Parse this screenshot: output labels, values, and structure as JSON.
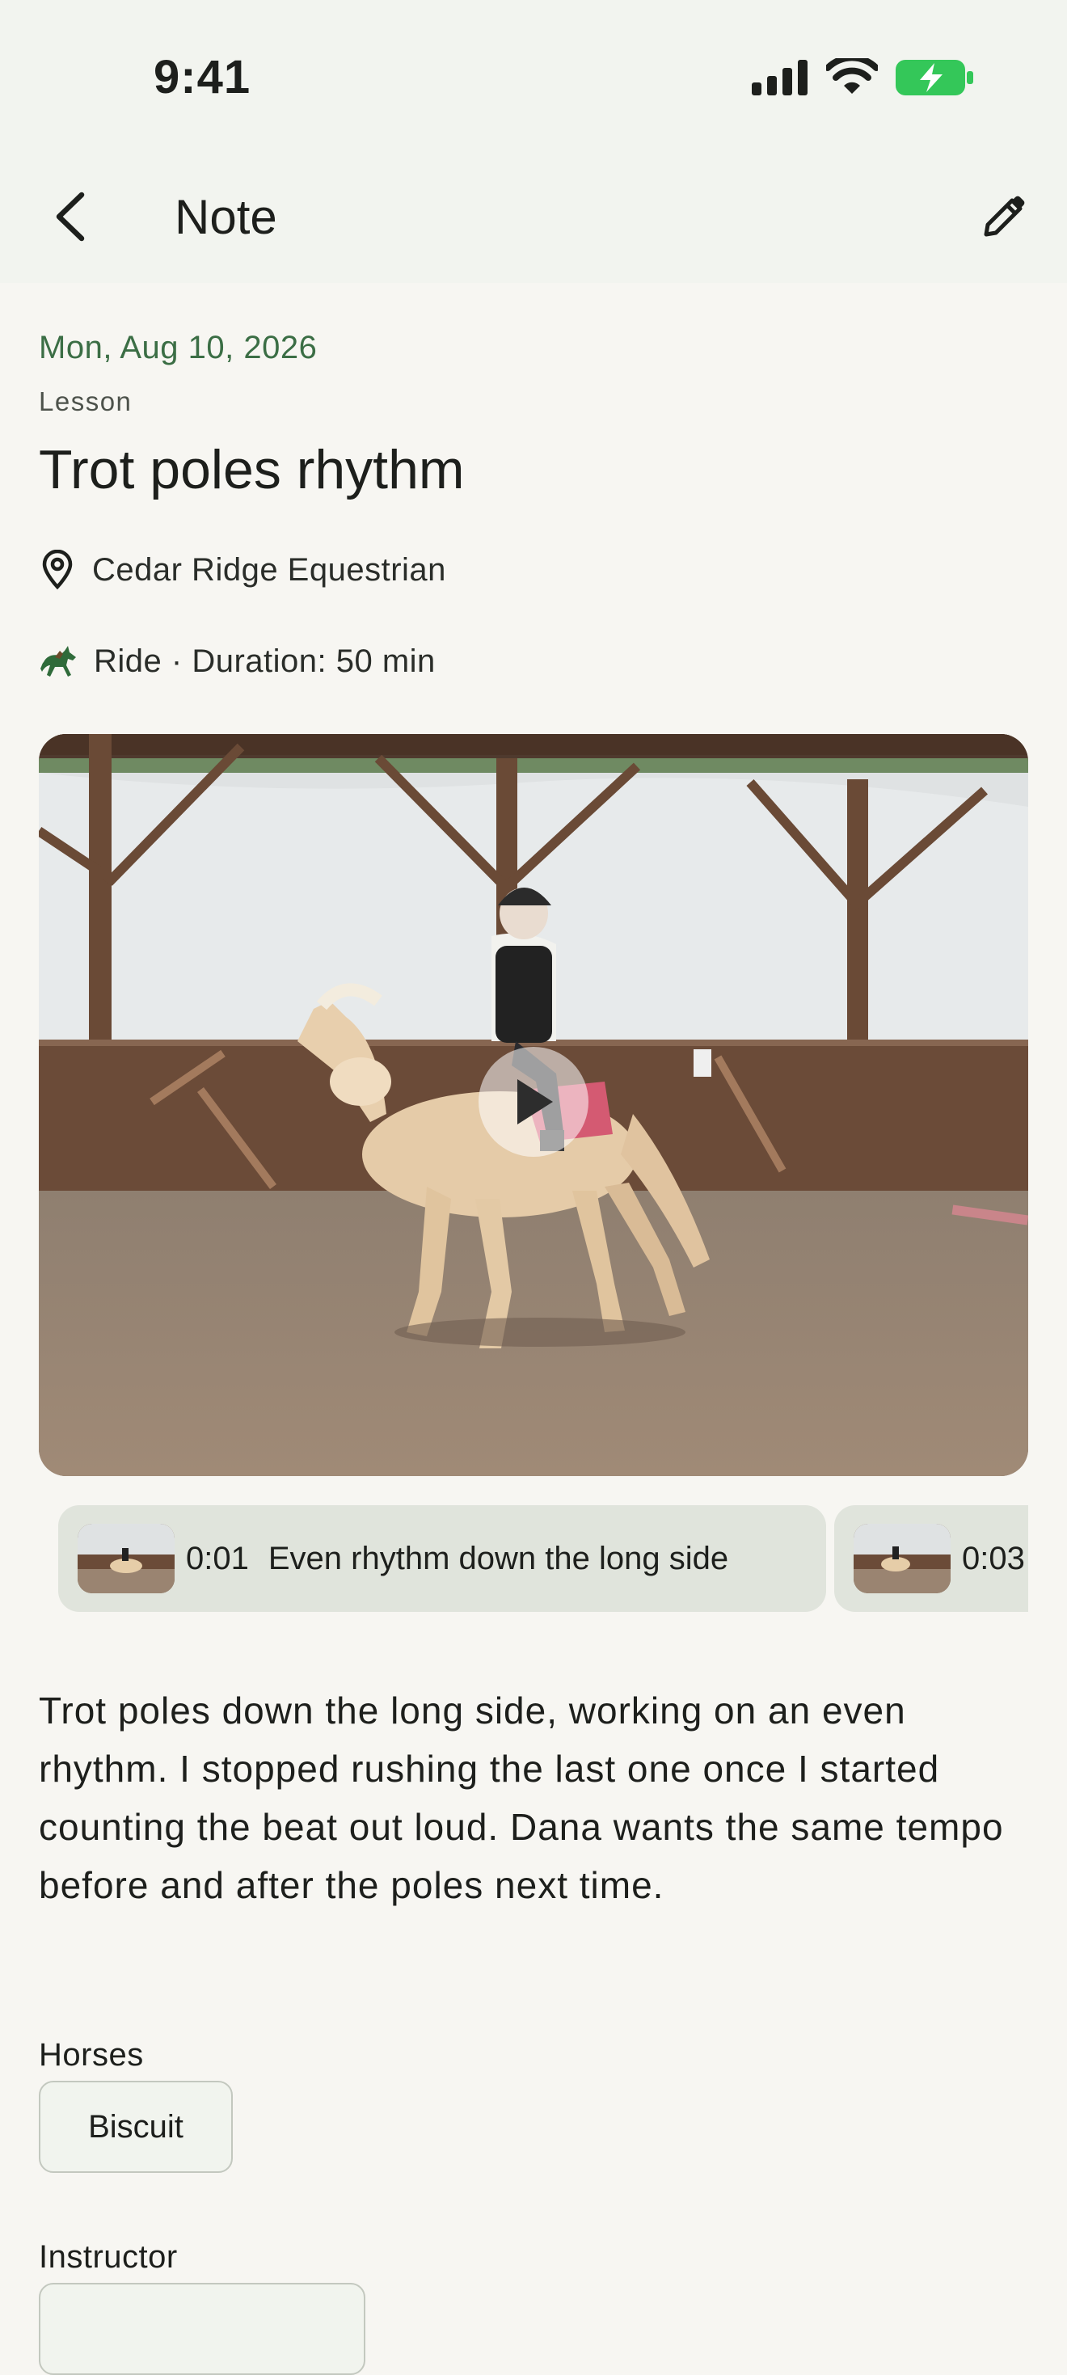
{
  "status_bar": {
    "time": "9:41"
  },
  "app_bar": {
    "title": "Note"
  },
  "note": {
    "date": "Mon, Aug 10, 2026",
    "kind": "Lesson",
    "title": "Trot poles rhythm",
    "location": "Cedar Ridge Equestrian",
    "ride_info": "Ride · Duration: 50 min",
    "body": "Trot poles down the long side, working on an even rhythm. I stopped rushing the last one once I started counting the beat out loud. Dana wants the same tempo before and after the poles next time."
  },
  "clips": [
    {
      "time": "0:01",
      "label": "Even rhythm down the long side"
    },
    {
      "time": "0:03",
      "label": ""
    }
  ],
  "horses": {
    "label": "Horses",
    "items": [
      "Biscuit"
    ]
  },
  "instructor": {
    "label": "Instructor"
  },
  "colors": {
    "accent_green": "#3b6e45",
    "battery_green": "#34c759",
    "chip_bg": "#e0e4dc",
    "background": "#f7f6f2"
  }
}
